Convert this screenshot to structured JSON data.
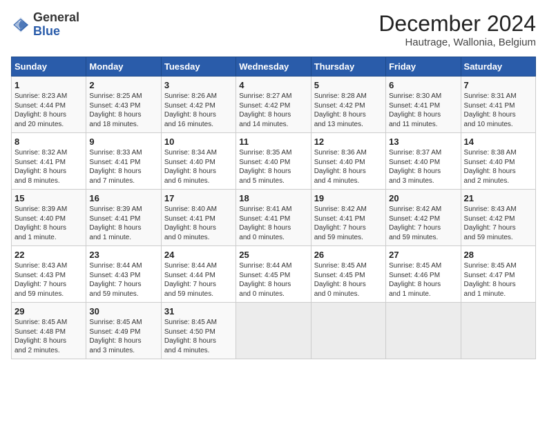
{
  "header": {
    "logo_general": "General",
    "logo_blue": "Blue",
    "month_title": "December 2024",
    "subtitle": "Hautrage, Wallonia, Belgium"
  },
  "days_of_week": [
    "Sunday",
    "Monday",
    "Tuesday",
    "Wednesday",
    "Thursday",
    "Friday",
    "Saturday"
  ],
  "weeks": [
    [
      {
        "day": "1",
        "lines": [
          "Sunrise: 8:23 AM",
          "Sunset: 4:44 PM",
          "Daylight: 8 hours",
          "and 20 minutes."
        ]
      },
      {
        "day": "2",
        "lines": [
          "Sunrise: 8:25 AM",
          "Sunset: 4:43 PM",
          "Daylight: 8 hours",
          "and 18 minutes."
        ]
      },
      {
        "day": "3",
        "lines": [
          "Sunrise: 8:26 AM",
          "Sunset: 4:42 PM",
          "Daylight: 8 hours",
          "and 16 minutes."
        ]
      },
      {
        "day": "4",
        "lines": [
          "Sunrise: 8:27 AM",
          "Sunset: 4:42 PM",
          "Daylight: 8 hours",
          "and 14 minutes."
        ]
      },
      {
        "day": "5",
        "lines": [
          "Sunrise: 8:28 AM",
          "Sunset: 4:42 PM",
          "Daylight: 8 hours",
          "and 13 minutes."
        ]
      },
      {
        "day": "6",
        "lines": [
          "Sunrise: 8:30 AM",
          "Sunset: 4:41 PM",
          "Daylight: 8 hours",
          "and 11 minutes."
        ]
      },
      {
        "day": "7",
        "lines": [
          "Sunrise: 8:31 AM",
          "Sunset: 4:41 PM",
          "Daylight: 8 hours",
          "and 10 minutes."
        ]
      }
    ],
    [
      {
        "day": "8",
        "lines": [
          "Sunrise: 8:32 AM",
          "Sunset: 4:41 PM",
          "Daylight: 8 hours",
          "and 8 minutes."
        ]
      },
      {
        "day": "9",
        "lines": [
          "Sunrise: 8:33 AM",
          "Sunset: 4:41 PM",
          "Daylight: 8 hours",
          "and 7 minutes."
        ]
      },
      {
        "day": "10",
        "lines": [
          "Sunrise: 8:34 AM",
          "Sunset: 4:40 PM",
          "Daylight: 8 hours",
          "and 6 minutes."
        ]
      },
      {
        "day": "11",
        "lines": [
          "Sunrise: 8:35 AM",
          "Sunset: 4:40 PM",
          "Daylight: 8 hours",
          "and 5 minutes."
        ]
      },
      {
        "day": "12",
        "lines": [
          "Sunrise: 8:36 AM",
          "Sunset: 4:40 PM",
          "Daylight: 8 hours",
          "and 4 minutes."
        ]
      },
      {
        "day": "13",
        "lines": [
          "Sunrise: 8:37 AM",
          "Sunset: 4:40 PM",
          "Daylight: 8 hours",
          "and 3 minutes."
        ]
      },
      {
        "day": "14",
        "lines": [
          "Sunrise: 8:38 AM",
          "Sunset: 4:40 PM",
          "Daylight: 8 hours",
          "and 2 minutes."
        ]
      }
    ],
    [
      {
        "day": "15",
        "lines": [
          "Sunrise: 8:39 AM",
          "Sunset: 4:40 PM",
          "Daylight: 8 hours",
          "and 1 minute."
        ]
      },
      {
        "day": "16",
        "lines": [
          "Sunrise: 8:39 AM",
          "Sunset: 4:41 PM",
          "Daylight: 8 hours",
          "and 1 minute."
        ]
      },
      {
        "day": "17",
        "lines": [
          "Sunrise: 8:40 AM",
          "Sunset: 4:41 PM",
          "Daylight: 8 hours",
          "and 0 minutes."
        ]
      },
      {
        "day": "18",
        "lines": [
          "Sunrise: 8:41 AM",
          "Sunset: 4:41 PM",
          "Daylight: 8 hours",
          "and 0 minutes."
        ]
      },
      {
        "day": "19",
        "lines": [
          "Sunrise: 8:42 AM",
          "Sunset: 4:41 PM",
          "Daylight: 7 hours",
          "and 59 minutes."
        ]
      },
      {
        "day": "20",
        "lines": [
          "Sunrise: 8:42 AM",
          "Sunset: 4:42 PM",
          "Daylight: 7 hours",
          "and 59 minutes."
        ]
      },
      {
        "day": "21",
        "lines": [
          "Sunrise: 8:43 AM",
          "Sunset: 4:42 PM",
          "Daylight: 7 hours",
          "and 59 minutes."
        ]
      }
    ],
    [
      {
        "day": "22",
        "lines": [
          "Sunrise: 8:43 AM",
          "Sunset: 4:43 PM",
          "Daylight: 7 hours",
          "and 59 minutes."
        ]
      },
      {
        "day": "23",
        "lines": [
          "Sunrise: 8:44 AM",
          "Sunset: 4:43 PM",
          "Daylight: 7 hours",
          "and 59 minutes."
        ]
      },
      {
        "day": "24",
        "lines": [
          "Sunrise: 8:44 AM",
          "Sunset: 4:44 PM",
          "Daylight: 7 hours",
          "and 59 minutes."
        ]
      },
      {
        "day": "25",
        "lines": [
          "Sunrise: 8:44 AM",
          "Sunset: 4:45 PM",
          "Daylight: 8 hours",
          "and 0 minutes."
        ]
      },
      {
        "day": "26",
        "lines": [
          "Sunrise: 8:45 AM",
          "Sunset: 4:45 PM",
          "Daylight: 8 hours",
          "and 0 minutes."
        ]
      },
      {
        "day": "27",
        "lines": [
          "Sunrise: 8:45 AM",
          "Sunset: 4:46 PM",
          "Daylight: 8 hours",
          "and 1 minute."
        ]
      },
      {
        "day": "28",
        "lines": [
          "Sunrise: 8:45 AM",
          "Sunset: 4:47 PM",
          "Daylight: 8 hours",
          "and 1 minute."
        ]
      }
    ],
    [
      {
        "day": "29",
        "lines": [
          "Sunrise: 8:45 AM",
          "Sunset: 4:48 PM",
          "Daylight: 8 hours",
          "and 2 minutes."
        ]
      },
      {
        "day": "30",
        "lines": [
          "Sunrise: 8:45 AM",
          "Sunset: 4:49 PM",
          "Daylight: 8 hours",
          "and 3 minutes."
        ]
      },
      {
        "day": "31",
        "lines": [
          "Sunrise: 8:45 AM",
          "Sunset: 4:50 PM",
          "Daylight: 8 hours",
          "and 4 minutes."
        ]
      },
      {
        "day": "",
        "lines": []
      },
      {
        "day": "",
        "lines": []
      },
      {
        "day": "",
        "lines": []
      },
      {
        "day": "",
        "lines": []
      }
    ]
  ]
}
